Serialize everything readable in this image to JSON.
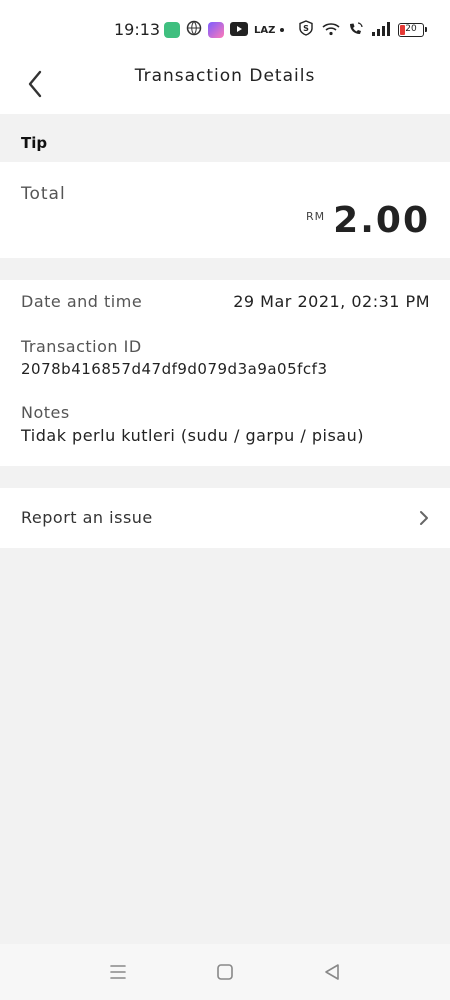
{
  "status_bar": {
    "time": "19:13",
    "carrier_badge": "LAZ",
    "battery": "20",
    "icons": [
      "app-green-icon",
      "vpn-globe-icon",
      "app-purple-icon",
      "youtube-icon",
      "shopee-s-icon",
      "wifi-icon",
      "wifi-call-icon",
      "signal-icon",
      "battery-icon"
    ]
  },
  "header": {
    "title": "Transaction Details",
    "back_icon": "back-arrow-icon"
  },
  "tip": {
    "label": "Tip"
  },
  "total": {
    "label": "Total",
    "currency": "RM",
    "amount": "2.00"
  },
  "details": {
    "date_label": "Date and time",
    "date_value": "29 Mar 2021, 02:31 PM",
    "txid_label": "Transaction ID",
    "txid_value": "2078b416857d47df9d079d3a9a05fcf3",
    "notes_label": "Notes",
    "notes_value": "Tidak perlu kutleri (sudu / garpu / pisau)"
  },
  "report": {
    "label": "Report an issue",
    "icon": "chevron-right-icon"
  },
  "nav": {
    "menu_icon": "menu-icon",
    "home_icon": "home-square-icon",
    "back_icon": "back-triangle-icon"
  },
  "colors": {
    "background": "#f2f2f2",
    "card": "#ffffff",
    "text_primary": "#222222",
    "text_secondary": "#555555",
    "battery_low": "#e53935"
  }
}
